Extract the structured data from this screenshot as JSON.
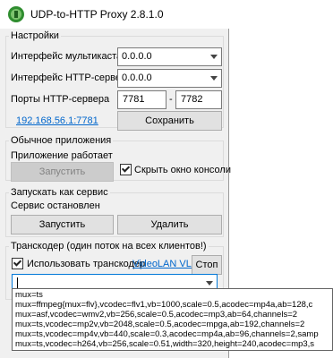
{
  "window": {
    "title": "UDP-to-HTTP Proxy 2.8.1.0"
  },
  "settings": {
    "group_label": "Настройки",
    "multicast_label": "Интерфейс мультикаста",
    "multicast_value": "0.0.0.0",
    "http_iface_label": "Интерфейс HTTP-сервера",
    "http_iface_value": "0.0.0.0",
    "ports_label": "Порты HTTP-сервера",
    "port_from": "7781",
    "port_sep": "-",
    "port_to": "7782",
    "url_link": "192.168.56.1:7781",
    "save_label": "Сохранить"
  },
  "app": {
    "group_label": "Обычное приложения",
    "status": "Приложение работает",
    "start_label": "Запустить",
    "hide_console_label": "Скрыть окно консоли",
    "hide_console_checked": true
  },
  "service": {
    "group_label": "Запускать как сервис",
    "status": "Сервис остановлен",
    "start_label": "Запустить",
    "remove_label": "Удалить"
  },
  "transcoder": {
    "group_label": "Транскодер (один поток на всех клиентов!)",
    "use_label": "Использовать транскодер",
    "use_checked": true,
    "vlc_link": "VideoLAN VLC",
    "stop_label": "Стоп",
    "combo_value": "",
    "options": [
      "mux=ts",
      "mux=ffmpeg{mux=flv},vcodec=flv1,vb=1000,scale=0.5,acodec=mp4a,ab=128,c",
      "mux=asf,vcodec=wmv2,vb=256,scale=0.5,acodec=mp3,ab=64,channels=2",
      "mux=ts,vcodec=mp2v,vb=2048,scale=0.5,acodec=mpga,ab=192,channels=2",
      "mux=ts,vcodec=mp4v,vb=440,scale=0.3,acodec=mp4a,ab=96,channels=2,samp",
      "mux=ts,vcodec=h264,vb=256,scale=0.51,width=320,height=240,acodec=mp3,s"
    ]
  },
  "icons": {
    "app": "app-globe-icon",
    "dropdown": "chevron-down-icon",
    "check": "checkmark-icon"
  }
}
